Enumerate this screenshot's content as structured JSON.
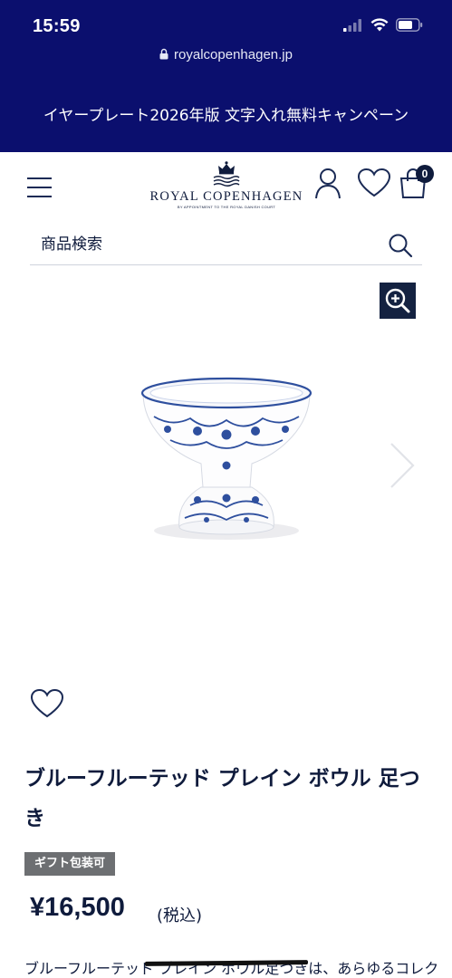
{
  "status_bar": {
    "time": "15:59"
  },
  "browser": {
    "url": "royalcopenhagen.jp"
  },
  "promo_banner": {
    "text": "イヤープレート2026年版 文字入れ無料キャンペーン"
  },
  "header": {
    "logo_text": "ROYAL COPENHAGEN",
    "logo_subtext": "BY APPOINTMENT TO THE ROYAL DANISH COURT",
    "cart_count": "0"
  },
  "search": {
    "placeholder": "商品検索"
  },
  "product": {
    "title": "ブルーフルーテッド プレイン ボウル 足つき",
    "badge": "ギフト包装可",
    "price": "¥16,500",
    "tax_note": "(税込)",
    "description": "ブルーフルーテッド プレイン ボウル足つきは、あらゆるコレク"
  },
  "icons": {
    "menu": "hamburger-menu-icon",
    "account": "user-icon",
    "wishlist": "heart-icon",
    "cart": "shopping-bag-icon",
    "search": "search-icon",
    "zoom": "zoom-in-icon",
    "next": "chevron-right-icon"
  },
  "colors": {
    "brand_navy": "#0b0f6e",
    "text_navy": "#0f1b3c",
    "badge_gray": "#6d6f72"
  }
}
